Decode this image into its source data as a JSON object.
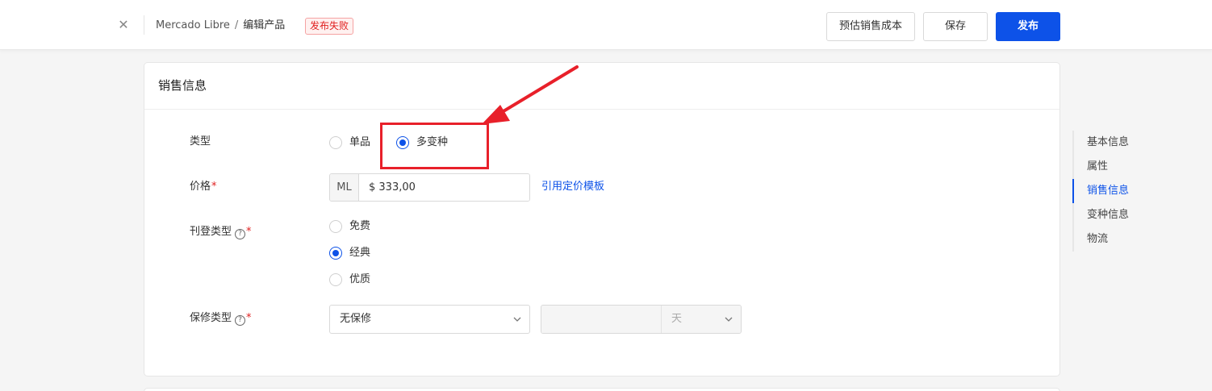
{
  "header": {
    "close_icon": "close-icon",
    "breadcrumb": {
      "root": "Mercado Libre",
      "separator": "/",
      "current": "编辑产品"
    },
    "status_badge": "发布失败",
    "buttons": {
      "estimate": "预估销售成本",
      "save": "保存",
      "publish": "发布"
    }
  },
  "colors": {
    "primary": "#0d52e8",
    "error": "#e02020",
    "annotation": "#e8202a"
  },
  "section": {
    "title": "销售信息",
    "type": {
      "label": "类型",
      "options": [
        "单品",
        "多变种"
      ],
      "selected": "多变种"
    },
    "price": {
      "label": "价格",
      "required": "*",
      "prefix": "ML",
      "value": "$ 333,00",
      "template_link": "引用定价模板"
    },
    "listing_type": {
      "label": "刊登类型",
      "help_icon": "question-circle-icon",
      "required": "*",
      "help_glyph": "?",
      "options": [
        "免费",
        "经典",
        "优质"
      ],
      "selected": "经典"
    },
    "warranty": {
      "label": "保修类型",
      "help_icon": "question-circle-icon",
      "required": "*",
      "help_glyph": "?",
      "value": "无保修",
      "duration_value": "",
      "unit": "天"
    }
  },
  "anchor_nav": {
    "items": [
      "基本信息",
      "属性",
      "销售信息",
      "变种信息",
      "物流"
    ],
    "active": "销售信息"
  },
  "annotation": {
    "type": "red-highlight-box-with-arrow",
    "target": "多变种"
  }
}
